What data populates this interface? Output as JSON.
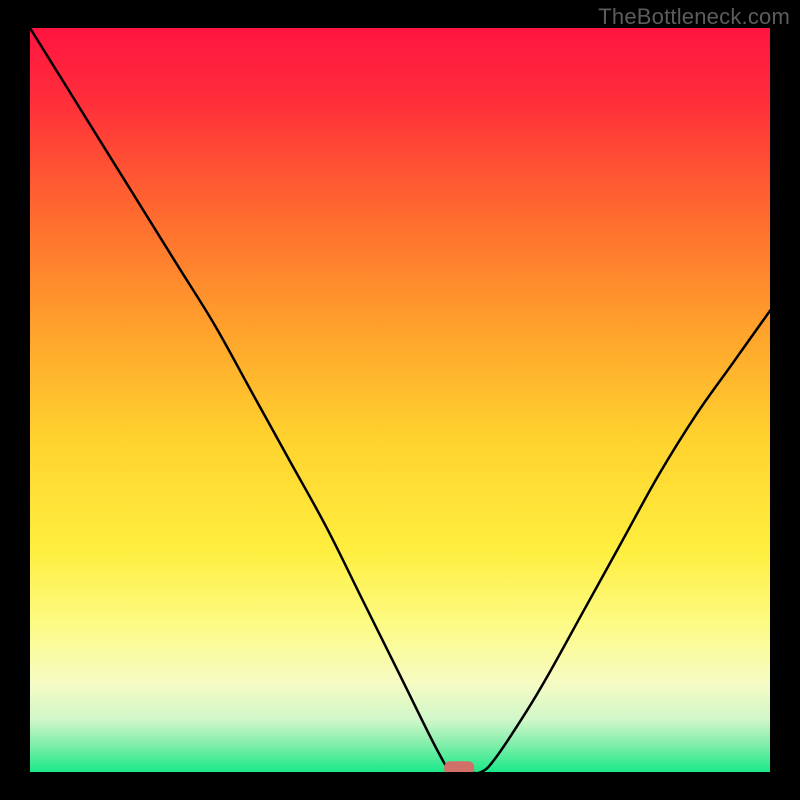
{
  "watermark": "TheBottleneck.com",
  "chart_data": {
    "type": "line",
    "title": "",
    "xlabel": "",
    "ylabel": "",
    "xlim": [
      0,
      100
    ],
    "ylim": [
      0,
      100
    ],
    "series": [
      {
        "name": "bottleneck-curve",
        "x": [
          0,
          5,
          10,
          15,
          20,
          25,
          30,
          35,
          40,
          45,
          50,
          55,
          57,
          59,
          61,
          63,
          67,
          70,
          75,
          80,
          85,
          90,
          95,
          100
        ],
        "values": [
          100,
          92,
          84,
          76,
          68,
          60,
          51,
          42,
          33,
          23,
          13,
          3,
          0,
          0,
          0,
          2,
          8,
          13,
          22,
          31,
          40,
          48,
          55,
          62
        ]
      }
    ],
    "marker": {
      "x": 58,
      "y": 0.5,
      "color": "#d17068"
    },
    "background_gradient": {
      "stops": [
        {
          "offset": 0.0,
          "color": "#ff1440"
        },
        {
          "offset": 0.1,
          "color": "#ff2f3a"
        },
        {
          "offset": 0.25,
          "color": "#ff6a2f"
        },
        {
          "offset": 0.4,
          "color": "#ffa02c"
        },
        {
          "offset": 0.55,
          "color": "#ffd22e"
        },
        {
          "offset": 0.7,
          "color": "#ffee3e"
        },
        {
          "offset": 0.8,
          "color": "#fdfb84"
        },
        {
          "offset": 0.88,
          "color": "#f6fbc3"
        },
        {
          "offset": 0.93,
          "color": "#d0f7c9"
        },
        {
          "offset": 0.965,
          "color": "#7ceea9"
        },
        {
          "offset": 1.0,
          "color": "#19e989"
        }
      ]
    }
  }
}
